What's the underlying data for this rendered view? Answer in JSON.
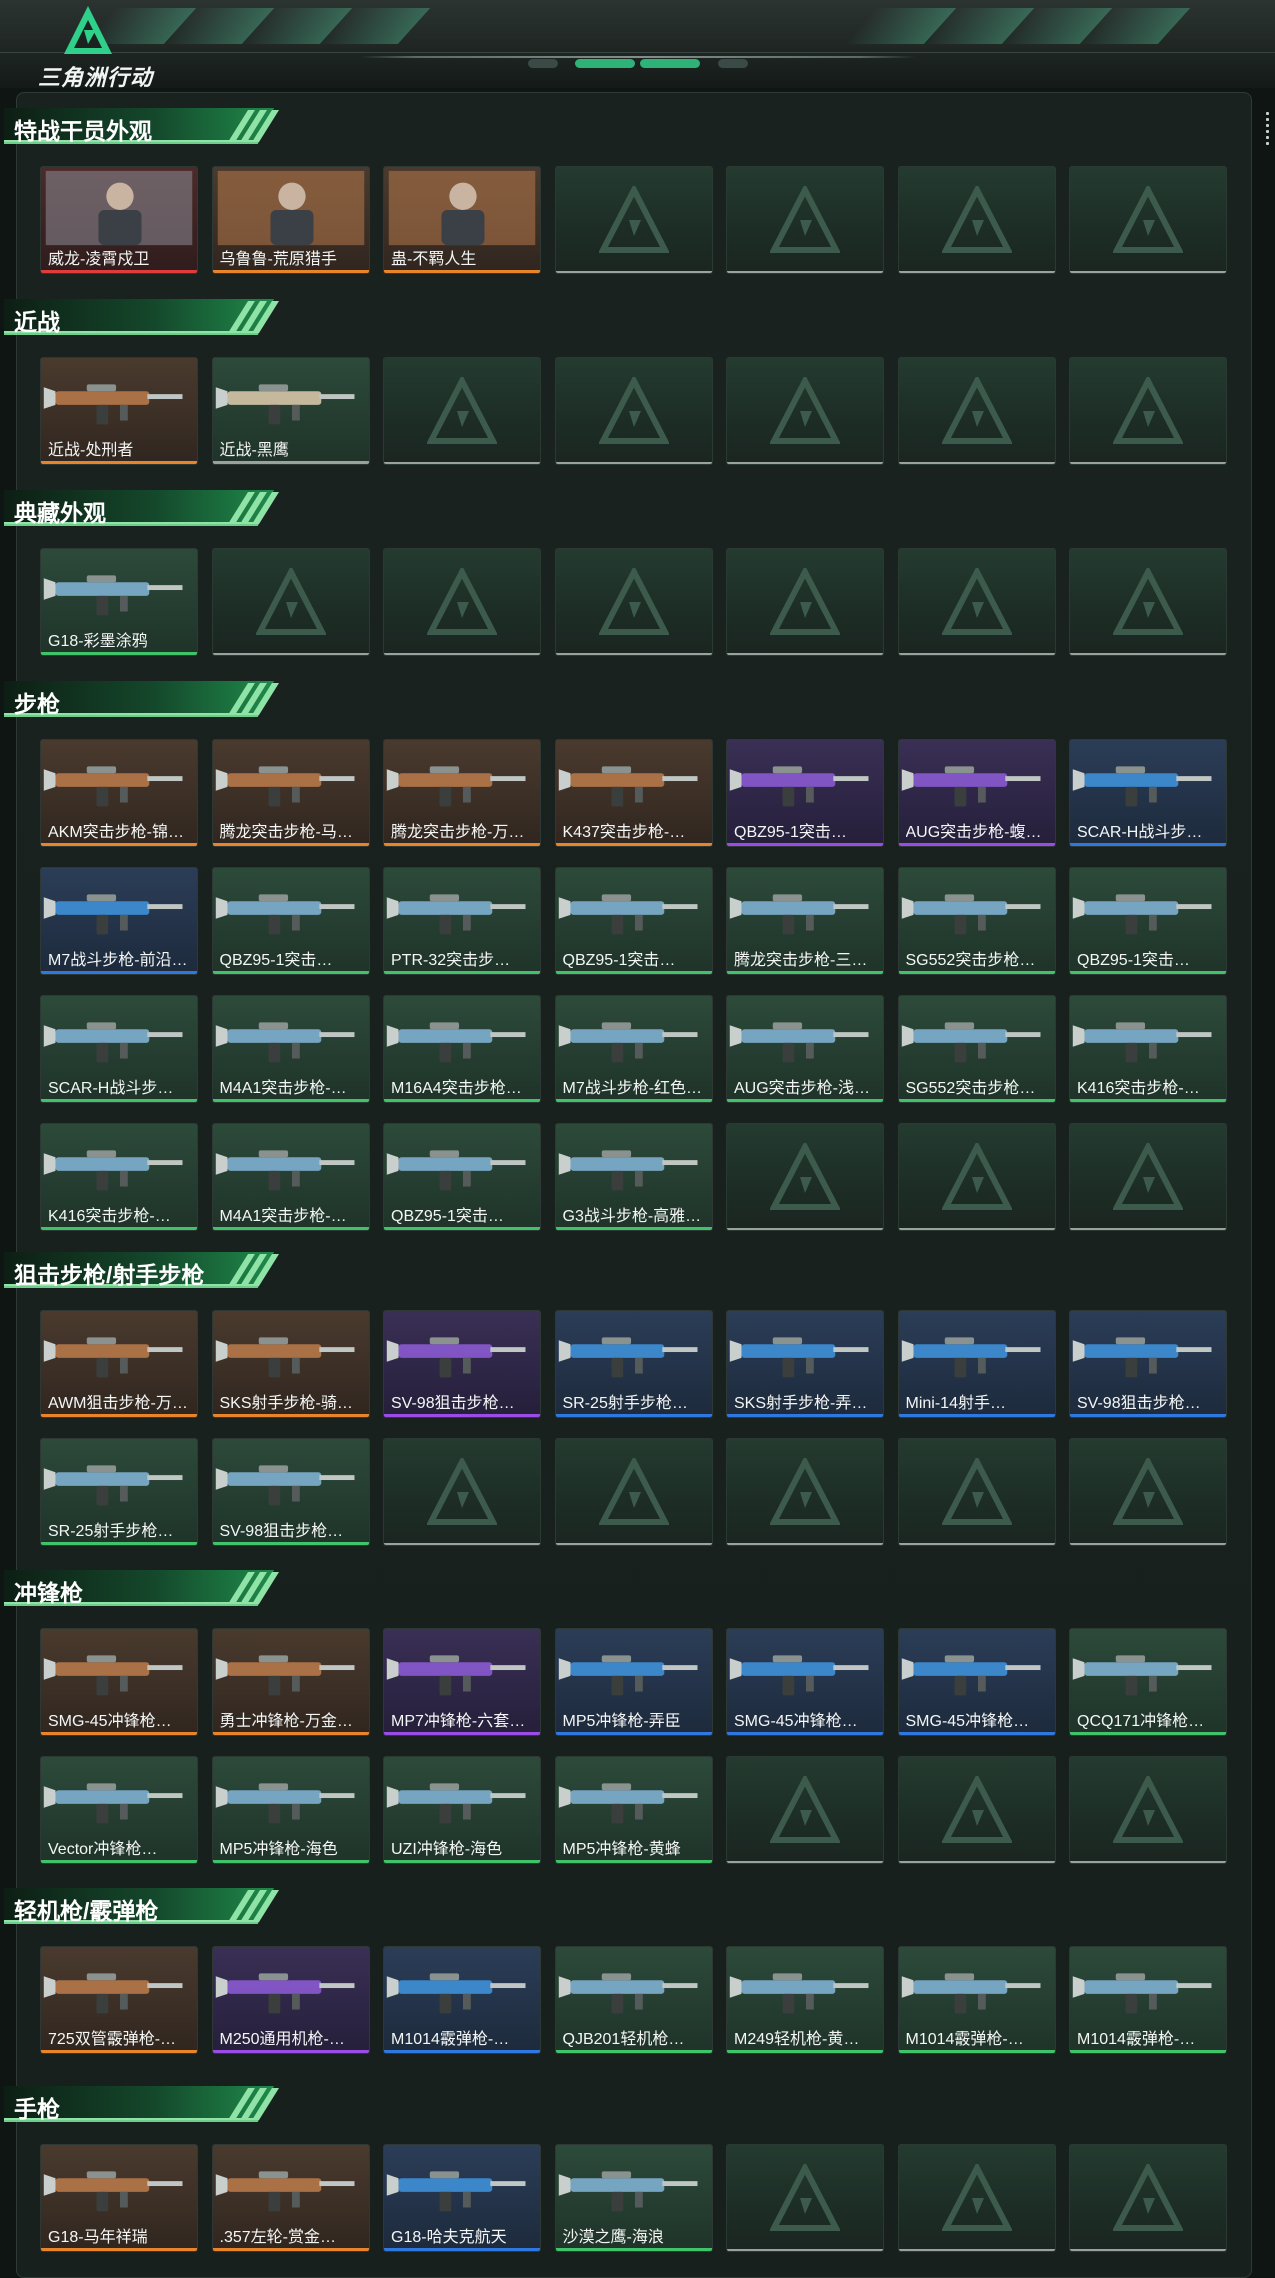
{
  "header": {
    "logo_text": "三角洲行动"
  },
  "colors": {
    "red": "#e23b3b",
    "orange": "#e8852a",
    "purple": "#9b4be6",
    "blue": "#2f78e0",
    "green": "#3fc46a",
    "gray": "#9aa29f"
  },
  "sections": [
    {
      "title": "特战干员外观",
      "items": [
        {
          "label": "威龙-凌霄戍卫",
          "rarity": "red"
        },
        {
          "label": "乌鲁鲁-荒原猎手",
          "rarity": "orange"
        },
        {
          "label": "蛊-不羁人生",
          "rarity": "orange"
        },
        {
          "label": "",
          "rarity": "empty"
        },
        {
          "label": "",
          "rarity": "empty"
        },
        {
          "label": "",
          "rarity": "empty"
        },
        {
          "label": "",
          "rarity": "empty"
        }
      ]
    },
    {
      "title": "近战",
      "items": [
        {
          "label": "近战-处刑者",
          "rarity": "orange"
        },
        {
          "label": "近战-黑鹰",
          "rarity": "gray"
        },
        {
          "label": "",
          "rarity": "empty"
        },
        {
          "label": "",
          "rarity": "empty"
        },
        {
          "label": "",
          "rarity": "empty"
        },
        {
          "label": "",
          "rarity": "empty"
        },
        {
          "label": "",
          "rarity": "empty"
        }
      ]
    },
    {
      "title": "典藏外观",
      "items": [
        {
          "label": "G18-彩墨涂鸦",
          "rarity": "green"
        },
        {
          "label": "",
          "rarity": "empty"
        },
        {
          "label": "",
          "rarity": "empty"
        },
        {
          "label": "",
          "rarity": "empty"
        },
        {
          "label": "",
          "rarity": "empty"
        },
        {
          "label": "",
          "rarity": "empty"
        },
        {
          "label": "",
          "rarity": "empty"
        }
      ]
    },
    {
      "title": "步枪",
      "items": [
        {
          "label": "AKM突击步枪-锦…",
          "rarity": "orange"
        },
        {
          "label": "腾龙突击步枪-马年…",
          "rarity": "orange"
        },
        {
          "label": "腾龙突击步枪-万金…",
          "rarity": "orange"
        },
        {
          "label": "K437突击步枪-…",
          "rarity": "orange"
        },
        {
          "label": "QBZ95-1突击…",
          "rarity": "purple"
        },
        {
          "label": "AUG突击步枪-蝮…",
          "rarity": "purple"
        },
        {
          "label": "SCAR-H战斗步…",
          "rarity": "blue"
        },
        {
          "label": "M7战斗步枪-前沿…",
          "rarity": "blue"
        },
        {
          "label": "QBZ95-1突击…",
          "rarity": "green"
        },
        {
          "label": "PTR-32突击步…",
          "rarity": "green"
        },
        {
          "label": "QBZ95-1突击…",
          "rarity": "green"
        },
        {
          "label": "腾龙突击步枪-三角…",
          "rarity": "green"
        },
        {
          "label": "SG552突击步枪…",
          "rarity": "green"
        },
        {
          "label": "QBZ95-1突击…",
          "rarity": "green"
        },
        {
          "label": "SCAR-H战斗步…",
          "rarity": "green"
        },
        {
          "label": "M4A1突击步枪-…",
          "rarity": "green"
        },
        {
          "label": "M16A4突击步枪…",
          "rarity": "green"
        },
        {
          "label": "M7战斗步枪-红色…",
          "rarity": "green"
        },
        {
          "label": "AUG突击步枪-浅…",
          "rarity": "green"
        },
        {
          "label": "SG552突击步枪…",
          "rarity": "green"
        },
        {
          "label": "K416突击步枪-…",
          "rarity": "green"
        },
        {
          "label": "K416突击步枪-…",
          "rarity": "green"
        },
        {
          "label": "M4A1突击步枪-…",
          "rarity": "green"
        },
        {
          "label": "QBZ95-1突击…",
          "rarity": "green"
        },
        {
          "label": "G3战斗步枪-高雅…",
          "rarity": "green"
        },
        {
          "label": "",
          "rarity": "empty"
        },
        {
          "label": "",
          "rarity": "empty"
        },
        {
          "label": "",
          "rarity": "empty"
        }
      ]
    },
    {
      "title": "狙击步枪/射手步枪",
      "items": [
        {
          "label": "AWM狙击步枪-万…",
          "rarity": "orange"
        },
        {
          "label": "SKS射手步枪-骑…",
          "rarity": "orange"
        },
        {
          "label": "SV-98狙击步枪…",
          "rarity": "purple"
        },
        {
          "label": "SR-25射手步枪…",
          "rarity": "blue"
        },
        {
          "label": "SKS射手步枪-弄…",
          "rarity": "blue"
        },
        {
          "label": "Mini-14射手…",
          "rarity": "blue"
        },
        {
          "label": "SV-98狙击步枪…",
          "rarity": "blue"
        },
        {
          "label": "SR-25射手步枪…",
          "rarity": "green"
        },
        {
          "label": "SV-98狙击步枪…",
          "rarity": "green"
        },
        {
          "label": "",
          "rarity": "empty"
        },
        {
          "label": "",
          "rarity": "empty"
        },
        {
          "label": "",
          "rarity": "empty"
        },
        {
          "label": "",
          "rarity": "empty"
        },
        {
          "label": "",
          "rarity": "empty"
        }
      ]
    },
    {
      "title": "冲锋枪",
      "items": [
        {
          "label": "SMG-45冲锋枪…",
          "rarity": "orange"
        },
        {
          "label": "勇士冲锋枪-万金泪…",
          "rarity": "orange"
        },
        {
          "label": "MP7冲锋枪-六套…",
          "rarity": "purple"
        },
        {
          "label": "MP5冲锋枪-弄臣",
          "rarity": "blue"
        },
        {
          "label": "SMG-45冲锋枪…",
          "rarity": "blue"
        },
        {
          "label": "SMG-45冲锋枪…",
          "rarity": "blue"
        },
        {
          "label": "QCQ171冲锋枪…",
          "rarity": "green"
        },
        {
          "label": "Vector冲锋枪…",
          "rarity": "green"
        },
        {
          "label": "MP5冲锋枪-海色",
          "rarity": "green"
        },
        {
          "label": "UZI冲锋枪-海色",
          "rarity": "green"
        },
        {
          "label": "MP5冲锋枪-黄蜂",
          "rarity": "green"
        },
        {
          "label": "",
          "rarity": "empty"
        },
        {
          "label": "",
          "rarity": "empty"
        },
        {
          "label": "",
          "rarity": "empty"
        }
      ]
    },
    {
      "title": "轻机枪/霰弹枪",
      "items": [
        {
          "label": "725双管霰弹枪-…",
          "rarity": "orange"
        },
        {
          "label": "M250通用机枪-…",
          "rarity": "purple"
        },
        {
          "label": "M1014霰弹枪-…",
          "rarity": "blue"
        },
        {
          "label": "QJB201轻机枪…",
          "rarity": "green"
        },
        {
          "label": "M249轻机枪-黄…",
          "rarity": "green"
        },
        {
          "label": "M1014霰弹枪-…",
          "rarity": "green"
        },
        {
          "label": "M1014霰弹枪-…",
          "rarity": "green"
        }
      ]
    },
    {
      "title": "手枪",
      "items": [
        {
          "label": "G18-马年祥瑞",
          "rarity": "orange"
        },
        {
          "label": ".357左轮-赏金…",
          "rarity": "orange"
        },
        {
          "label": "G18-哈夫克航天",
          "rarity": "blue"
        },
        {
          "label": "沙漠之鹰-海浪",
          "rarity": "green"
        },
        {
          "label": "",
          "rarity": "empty"
        },
        {
          "label": "",
          "rarity": "empty"
        },
        {
          "label": "",
          "rarity": "empty"
        }
      ]
    }
  ]
}
